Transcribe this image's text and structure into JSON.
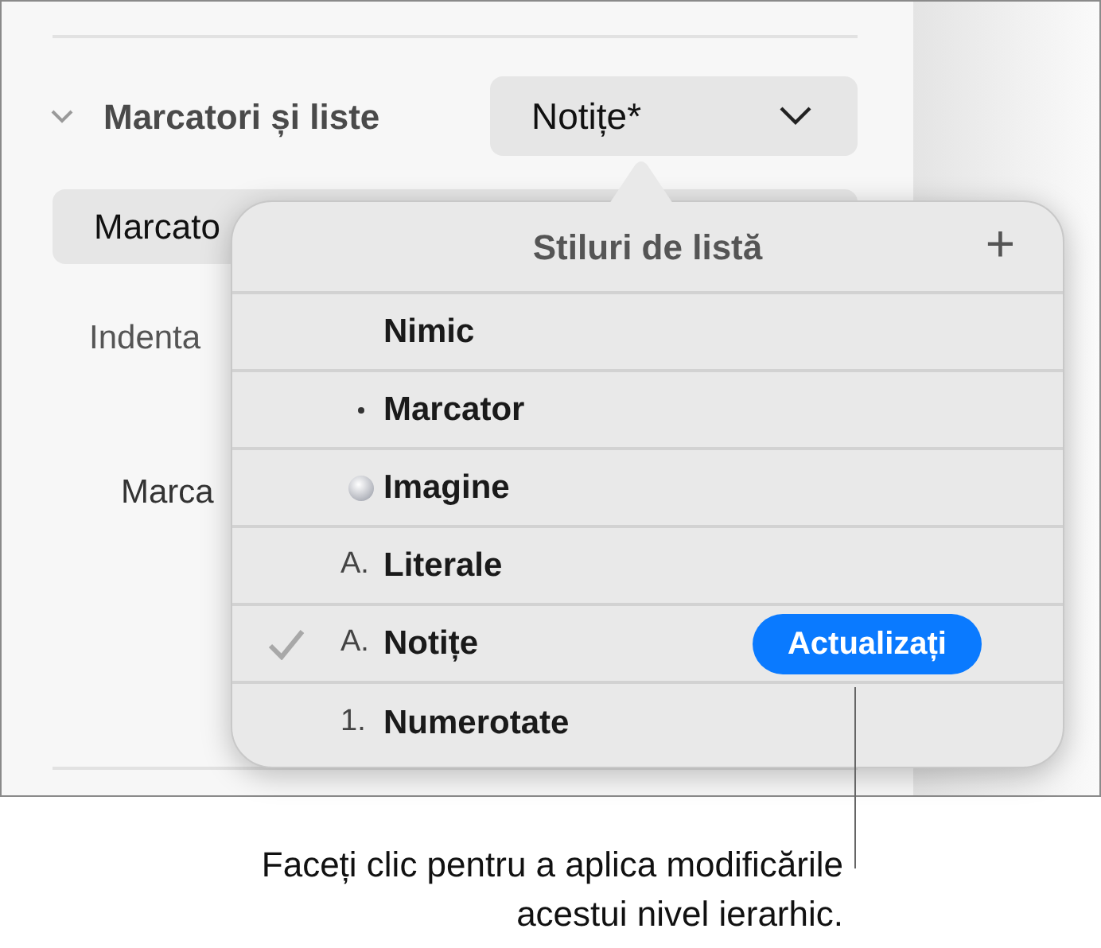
{
  "section": {
    "title": "Marcatori și liste",
    "expanded": true,
    "style_value": "Notițe*"
  },
  "behind": {
    "button_text": "Marcato",
    "label_1": "Indenta",
    "label_2": "Marca"
  },
  "popover": {
    "title": "Stiluri de listă",
    "add": "+",
    "items": [
      {
        "kind": "none",
        "label": "Nimic",
        "checked": false
      },
      {
        "kind": "bullet",
        "label": "Marcator",
        "checked": false
      },
      {
        "kind": "image",
        "label": "Imagine",
        "checked": false
      },
      {
        "kind": "text",
        "prefix": "A.",
        "label": "Literale",
        "checked": false
      },
      {
        "kind": "text",
        "prefix": "A.",
        "label": "Notițe",
        "checked": true,
        "action": "Actualizați"
      },
      {
        "kind": "text",
        "prefix": "1.",
        "label": "Numerotate",
        "checked": false
      }
    ]
  },
  "callout": {
    "lines": [
      "Faceți clic pentru a aplica modificările",
      "acestui nivel ierarhic."
    ]
  }
}
